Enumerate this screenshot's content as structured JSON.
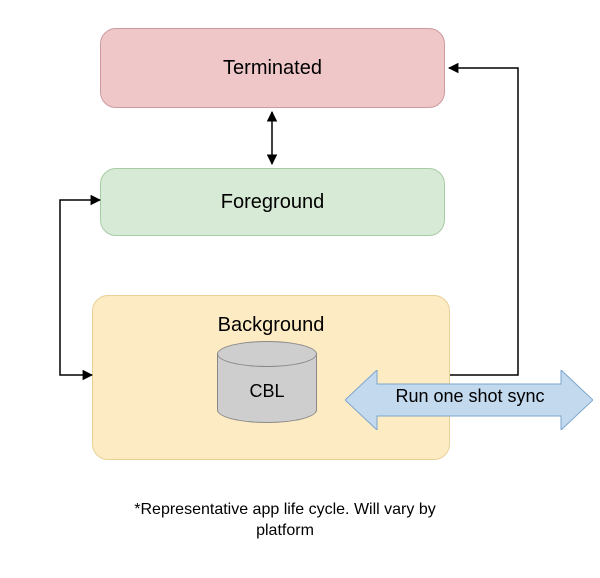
{
  "states": {
    "terminated": {
      "label": "Terminated",
      "fill": "#efc7c9",
      "border": "#cc9aa0"
    },
    "foreground": {
      "label": "Foreground",
      "fill": "#d7ead5",
      "border": "#a8cca5"
    },
    "background": {
      "label": "Background",
      "fill": "#fdebc3",
      "border": "#e8d099"
    }
  },
  "database": {
    "label": "CBL"
  },
  "sync": {
    "label": "Run one shot sync"
  },
  "footnote": "*Representative app life cycle. Will vary by platform",
  "transitions": [
    {
      "from": "terminated",
      "to": "foreground",
      "bidirectional": true
    },
    {
      "from": "foreground",
      "to": "background",
      "via": "left-route",
      "bidirectional": true
    },
    {
      "from": "background",
      "to": "terminated",
      "via": "right-route",
      "bidirectional": false
    }
  ]
}
